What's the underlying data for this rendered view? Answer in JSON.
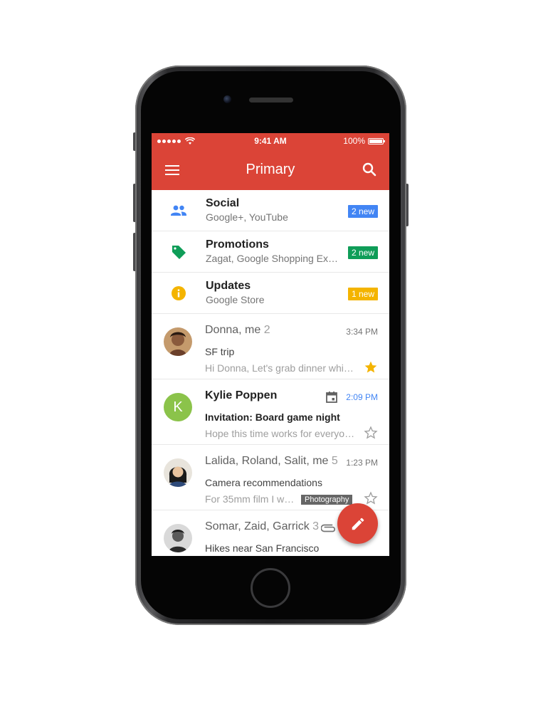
{
  "status_bar": {
    "time": "9:41 AM",
    "battery": "100%"
  },
  "app_bar": {
    "title": "Primary"
  },
  "categories": [
    {
      "title": "Social",
      "subtitle": "Google+, YouTube",
      "badge": "2 new",
      "badge_color": "#4285f4",
      "icon": "people-icon"
    },
    {
      "title": "Promotions",
      "subtitle": "Zagat, Google Shopping Ex…",
      "badge": "2 new",
      "badge_color": "#0f9d58",
      "icon": "tag-icon"
    },
    {
      "title": "Updates",
      "subtitle": "Google Store",
      "badge": "1 new",
      "badge_color": "#f4b400",
      "icon": "info-icon"
    }
  ],
  "emails": [
    {
      "sender": "Donna, me",
      "count": "2",
      "time": "3:34 PM",
      "subject": "SF trip",
      "snippet": "Hi Donna, Let's grab dinner whil…",
      "starred": true
    },
    {
      "sender": "Kylie Poppen",
      "avatar_letter": "K",
      "time": "2:09 PM",
      "subject": "Invitation: Board game night",
      "snippet": "Hope this time works for everyo…",
      "starred": false
    },
    {
      "sender": "Lalida, Roland, Salit, me",
      "count": "5",
      "time": "1:23 PM",
      "subject": "Camera recommendations",
      "snippet": "For 35mm film I w…",
      "label": "Photography",
      "starred": false
    },
    {
      "sender": "Somar, Zaid, Garrick",
      "count": "3",
      "subject": "Hikes near San Francisco",
      "starred": true
    }
  ],
  "colors": {
    "brand_red": "#db4437",
    "star_yellow": "#f4b400",
    "avatar_green": "#8bc34a"
  }
}
